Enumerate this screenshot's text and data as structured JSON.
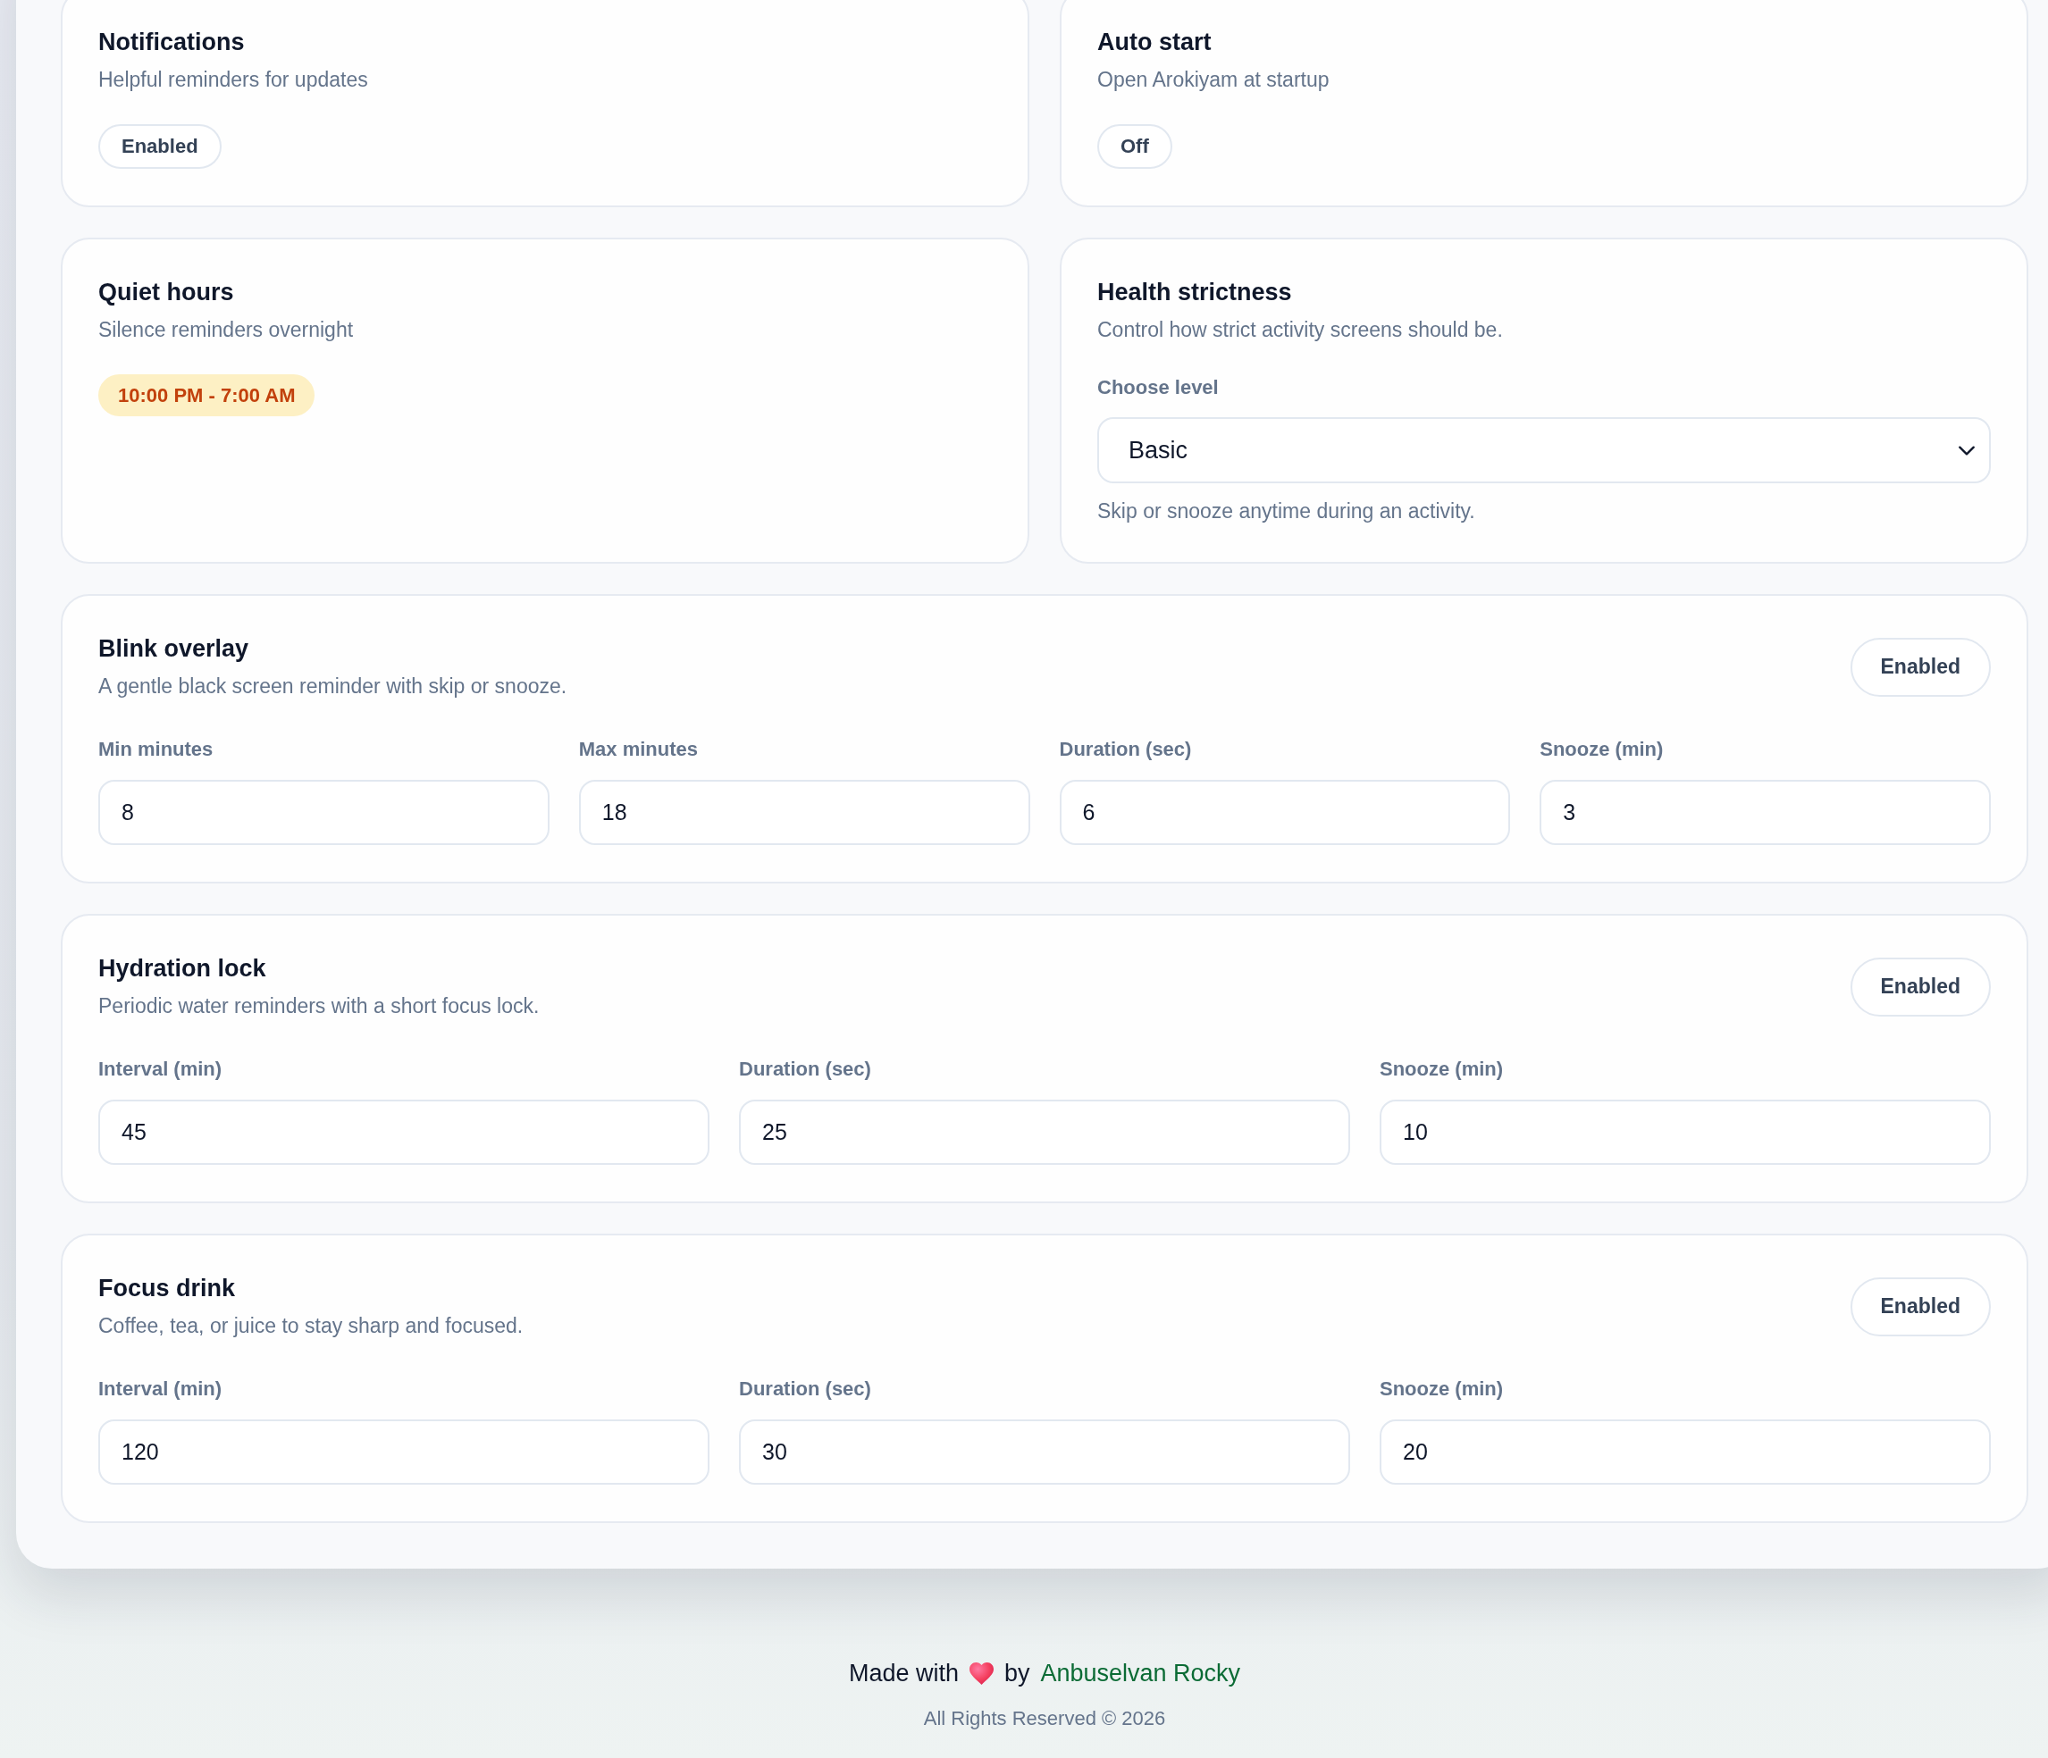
{
  "top_cards": [
    {
      "kind": "status",
      "title": "Notifications",
      "description": "Helpful reminders for updates",
      "button": "Enabled"
    },
    {
      "kind": "status",
      "title": "Auto start",
      "description": "Open Arokiyam at startup",
      "button": "Off"
    },
    {
      "kind": "time_range",
      "title": "Quiet hours",
      "description": "Silence reminders overnight",
      "badge": "10:00 PM - 7:00 AM"
    },
    {
      "kind": "select",
      "title": "Health strictness",
      "description": "Control how strict activity screens should be.",
      "field_label": "Choose level",
      "value": "Basic",
      "help": "Skip or snooze anytime during an activity."
    }
  ],
  "activity_cards": [
    {
      "title": "Blink overlay",
      "description": "A gentle black screen reminder with skip or snooze.",
      "button": "Enabled",
      "fields": [
        {
          "label": "Min minutes",
          "value": "8"
        },
        {
          "label": "Max minutes",
          "value": "18"
        },
        {
          "label": "Duration (sec)",
          "value": "6"
        },
        {
          "label": "Snooze (min)",
          "value": "3"
        }
      ]
    },
    {
      "title": "Hydration lock",
      "description": "Periodic water reminders with a short focus lock.",
      "button": "Enabled",
      "fields": [
        {
          "label": "Interval (min)",
          "value": "45"
        },
        {
          "label": "Duration (sec)",
          "value": "25"
        },
        {
          "label": "Snooze (min)",
          "value": "10"
        }
      ]
    },
    {
      "title": "Focus drink",
      "description": "Coffee, tea, or juice to stay sharp and focused.",
      "button": "Enabled",
      "fields": [
        {
          "label": "Interval (min)",
          "value": "120"
        },
        {
          "label": "Duration (sec)",
          "value": "30"
        },
        {
          "label": "Snooze (min)",
          "value": "20"
        }
      ]
    }
  ],
  "footer": {
    "made_with": "Made with",
    "by": "by",
    "author": "Anbuselvan Rocky",
    "copyright": "All Rights Reserved © 2026"
  }
}
